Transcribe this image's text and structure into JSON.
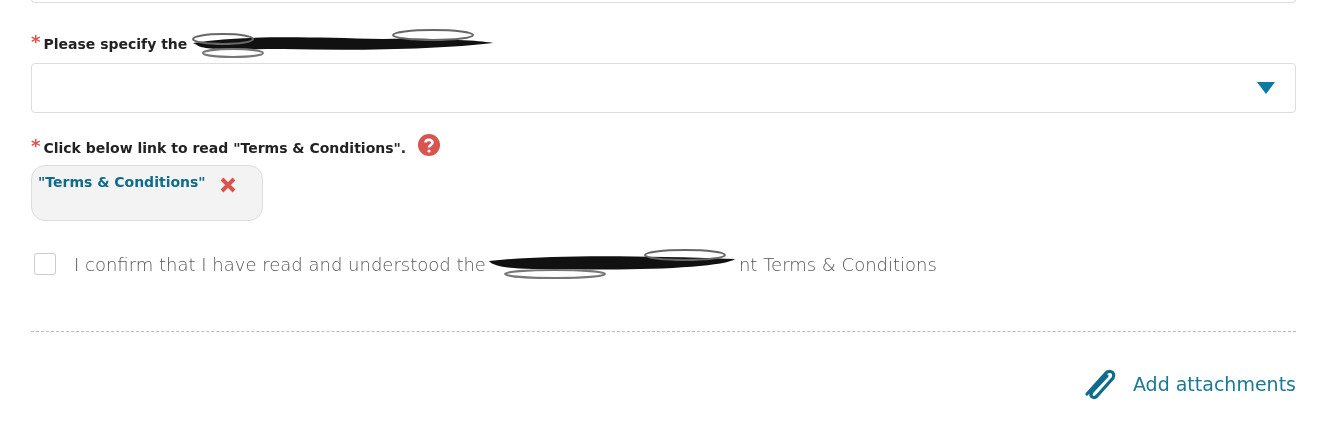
{
  "fields": [
    {
      "kind": "select",
      "required_mark": "*",
      "label": "Please specify the"
    },
    {
      "kind": "link",
      "required_mark": "*",
      "label": "Click below link to read \"Terms & Conditions\".",
      "link": "\"Terms & Conditions\""
    }
  ],
  "confirm": {
    "checked": false,
    "text_before": "I confirm that I have read and understood the",
    "text_after": "nt Terms & Conditions"
  },
  "attachments": {
    "label": "Add attachments"
  }
}
